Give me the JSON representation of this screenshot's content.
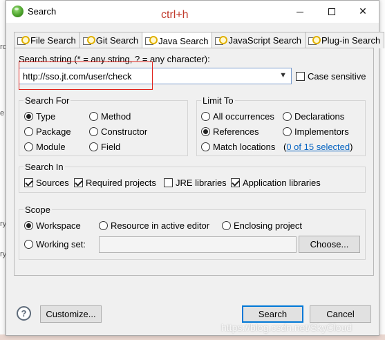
{
  "window": {
    "title": "Search",
    "hint": "ctrl+h"
  },
  "tabs": [
    {
      "label": "File Search"
    },
    {
      "label": "Git Search"
    },
    {
      "label": "Java Search"
    },
    {
      "label": "JavaScript Search"
    },
    {
      "label": "Plug-in Search"
    }
  ],
  "search": {
    "label": "Search string (* = any string, ? = any character):",
    "value": "http://sso.jt.com/user/check",
    "case_sensitive_label": "Case sensitive"
  },
  "search_for": {
    "title": "Search For",
    "options": [
      "Type",
      "Method",
      "Package",
      "Constructor",
      "Module",
      "Field"
    ],
    "selected": "Type"
  },
  "limit_to": {
    "title": "Limit To",
    "options": [
      "All occurrences",
      "Declarations",
      "References",
      "Implementors",
      "Match locations"
    ],
    "selected": "References",
    "selected_count_link": "0 of 15 selected",
    "open_paren": "(",
    "close_paren": ")"
  },
  "search_in": {
    "title": "Search In",
    "items": [
      {
        "label": "Sources",
        "checked": true
      },
      {
        "label": "Required projects",
        "checked": true
      },
      {
        "label": "JRE libraries",
        "checked": false
      },
      {
        "label": "Application libraries",
        "checked": true
      }
    ]
  },
  "scope": {
    "title": "Scope",
    "options": [
      "Workspace",
      "Resource in active editor",
      "Enclosing project",
      "Working set:"
    ],
    "selected": "Workspace",
    "choose_label": "Choose..."
  },
  "footer": {
    "help": "?",
    "customize_label": "Customize...",
    "search_label": "Search",
    "cancel_label": "Cancel"
  },
  "watermark": "https://blog.csdn.net/SkyCloud",
  "background_fragments": [
    "ro",
    "e",
    "ry",
    "ry"
  ]
}
